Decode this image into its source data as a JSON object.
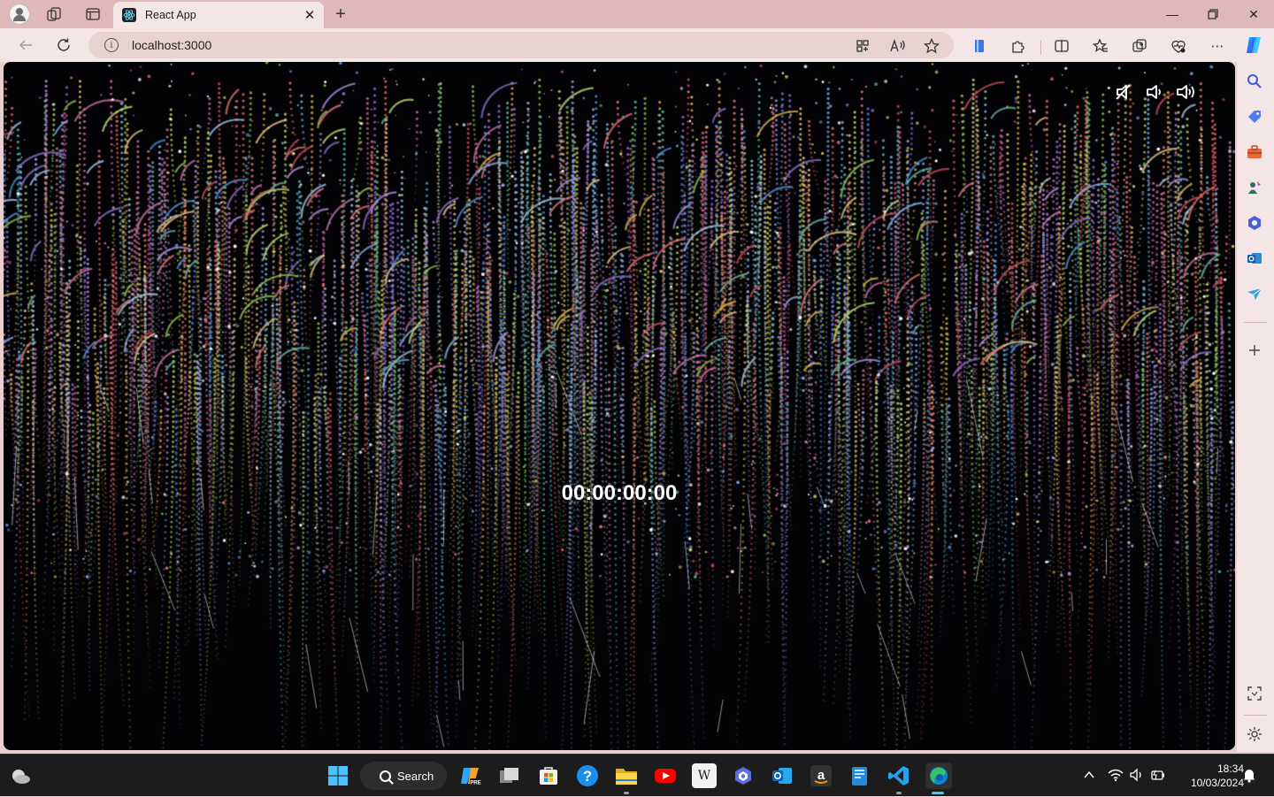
{
  "browser": {
    "tab": {
      "title": "React App"
    },
    "address": {
      "url": "localhost:3000"
    },
    "colors": {
      "titlebar": "#dfb9b9",
      "toolbar": "#f4e6e6",
      "omnibox": "#e9d2d2"
    }
  },
  "page": {
    "timer": "00:00:00:00",
    "background": "#030305",
    "sound_controls": [
      "mute-icon",
      "volume-low-icon",
      "volume-high-icon"
    ]
  },
  "sidebar": {
    "items": [
      "search-icon",
      "shopping-tag-icon",
      "tools-icon",
      "games-icon",
      "copilot-app-icon",
      "outlook-icon",
      "send-icon",
      "add-icon",
      "screenshot-icon",
      "settings-icon"
    ]
  },
  "taskbar": {
    "search_label": "Search",
    "apps": [
      "start-icon",
      "search",
      "copilot-pre-icon",
      "task-view-icon",
      "store-icon",
      "help-icon",
      "file-explorer-icon",
      "youtube-icon",
      "wikipedia-icon",
      "copilot-icon",
      "outlook-icon",
      "amazon-icon",
      "notepad-icon",
      "vscode-icon",
      "edge-icon"
    ],
    "wiki_letter": "W",
    "clock": {
      "time": "18:34",
      "date": "10/03/2024"
    }
  }
}
